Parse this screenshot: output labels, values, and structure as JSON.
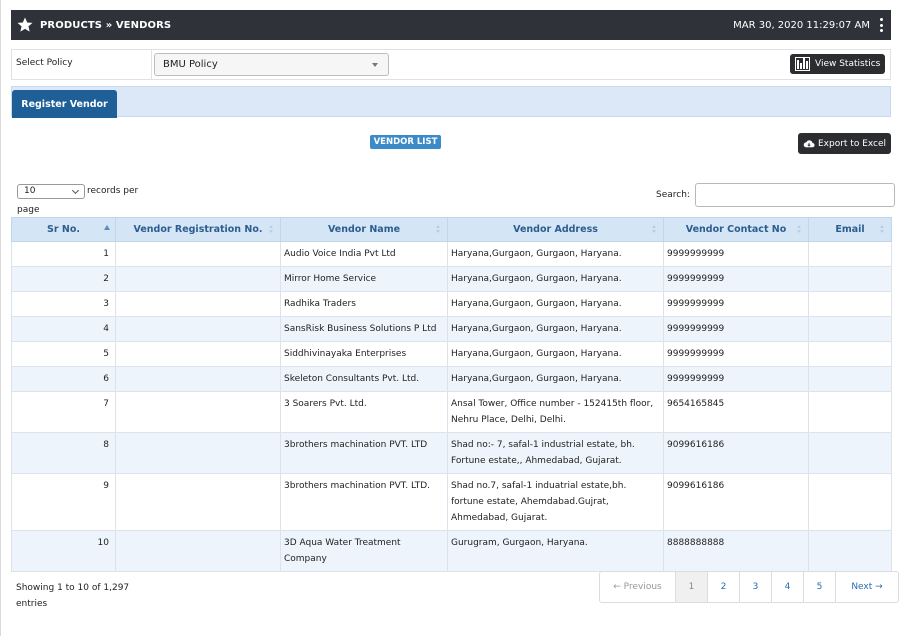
{
  "header": {
    "breadcrumb": "PRODUCTS » VENDORS",
    "datetime": "MAR 30, 2020  11:29:07 AM"
  },
  "policy": {
    "label": "Select Policy",
    "selected": "BMU Policy",
    "stats_button": "View Statistics"
  },
  "tabs": {
    "register": "Register Vendor"
  },
  "list": {
    "badge": "VENDOR LIST",
    "export_button": "Export to Excel",
    "length_value": "10",
    "length_label_1": "records per",
    "length_label_2": "page",
    "search_label": "Search:",
    "search_value": ""
  },
  "table": {
    "columns": [
      "Sr No.",
      "Vendor Registration No.",
      "Vendor Name",
      "Vendor Address",
      "Vendor Contact No",
      "Email"
    ],
    "rows": [
      {
        "sr": "1",
        "reg": "",
        "name": "Audio Voice India Pvt Ltd",
        "address": "Haryana,Gurgaon, Gurgaon, Haryana.",
        "contact": "9999999999",
        "email": ""
      },
      {
        "sr": "2",
        "reg": "",
        "name": "Mirror Home Service",
        "address": "Haryana,Gurgaon, Gurgaon, Haryana.",
        "contact": "9999999999",
        "email": ""
      },
      {
        "sr": "3",
        "reg": "",
        "name": "Radhika Traders",
        "address": "Haryana,Gurgaon, Gurgaon, Haryana.",
        "contact": "9999999999",
        "email": ""
      },
      {
        "sr": "4",
        "reg": "",
        "name": "SansRisk Business Solutions P Ltd",
        "address": "Haryana,Gurgaon, Gurgaon, Haryana.",
        "contact": "9999999999",
        "email": ""
      },
      {
        "sr": "5",
        "reg": "",
        "name": "Siddhivinayaka Enterprises",
        "address": "Haryana,Gurgaon, Gurgaon, Haryana.",
        "contact": "9999999999",
        "email": ""
      },
      {
        "sr": "6",
        "reg": "",
        "name": "Skeleton Consultants Pvt. Ltd.",
        "address": "Haryana,Gurgaon, Gurgaon, Haryana.",
        "contact": "9999999999",
        "email": ""
      },
      {
        "sr": "7",
        "reg": "",
        "name": "3 Soarers Pvt. Ltd.",
        "address": "Ansal Tower, Office number - 152415th floor, Nehru Place, Delhi, Delhi.",
        "contact": "9654165845",
        "email": ""
      },
      {
        "sr": "8",
        "reg": "",
        "name": "3brothers machination PVT. LTD",
        "address": "Shad no:- 7, safal-1 industrial estate, bh. Fortune estate,, Ahmedabad, Gujarat.",
        "contact": "9099616186",
        "email": ""
      },
      {
        "sr": "9",
        "reg": "",
        "name": "3brothers machination PVT. LTD.",
        "address": "Shad no.7, safal-1 induatrial estate,bh. fortune estate, Ahemdabad.Gujrat, Ahmedabad, Gujarat.",
        "contact": "9099616186",
        "email": ""
      },
      {
        "sr": "10",
        "reg": "",
        "name": "3D Aqua Water Treatment Company",
        "address": "Gurugram, Gurgaon, Haryana.",
        "contact": "8888888888",
        "email": ""
      }
    ]
  },
  "footer": {
    "info": "Showing 1 to 10 of 1,297 entries",
    "prev": "← Previous",
    "pages": [
      "1",
      "2",
      "3",
      "4",
      "5"
    ],
    "current_page": "1",
    "next": "Next →"
  },
  "colors": {
    "header_bg": "#2f3238",
    "accent": "#1e5f97",
    "table_header_bg": "#d4e5f6",
    "striped_row": "#edf4fc"
  }
}
